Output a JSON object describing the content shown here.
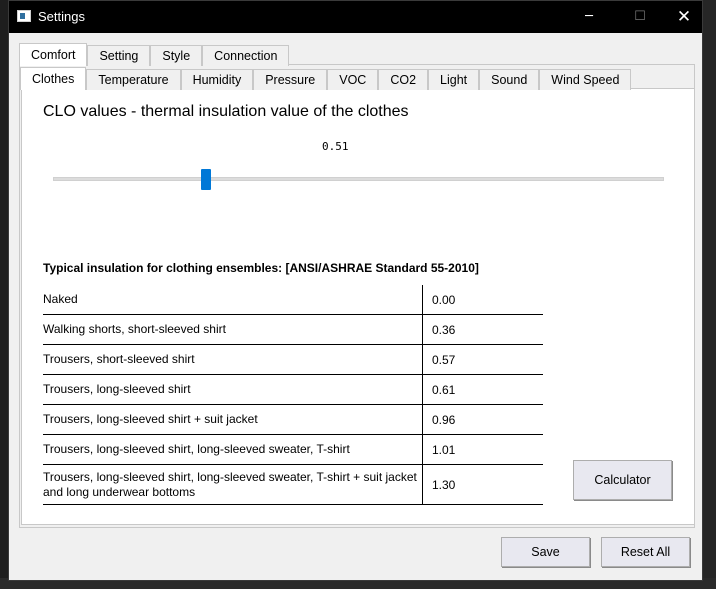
{
  "window": {
    "title": "Settings",
    "minimize": "─",
    "maximize": "☐",
    "close": "✕"
  },
  "tabs_top": [
    "Comfort",
    "Setting",
    "Style",
    "Connection"
  ],
  "tabs_sub": [
    "Clothes",
    "Temperature",
    "Humidity",
    "Pressure",
    "VOC",
    "CO2",
    "Light",
    "Sound",
    "Wind Speed"
  ],
  "clothes": {
    "heading": "CLO values - thermal insulation value of the clothes",
    "slider_value": "0.51",
    "slider_fraction": 0.25,
    "table_title": "Typical insulation for clothing ensembles: [ANSI/ASHRAE Standard 55-2010]",
    "rows": [
      {
        "label": "Naked",
        "value": "0.00"
      },
      {
        "label": "Walking shorts, short-sleeved shirt",
        "value": "0.36"
      },
      {
        "label": "Trousers, short-sleeved shirt",
        "value": "0.57"
      },
      {
        "label": "Trousers, long-sleeved shirt",
        "value": "0.61"
      },
      {
        "label": "Trousers, long-sleeved shirt + suit jacket",
        "value": "0.96"
      },
      {
        "label": "Trousers, long-sleeved shirt, long-sleeved sweater, T-shirt",
        "value": "1.01"
      },
      {
        "label": "Trousers, long-sleeved shirt, long-sleeved sweater, T-shirt + suit jacket and long underwear bottoms",
        "value": "1.30"
      }
    ],
    "calculator_label": "Calculator"
  },
  "footer": {
    "save_label": "Save",
    "reset_label": "Reset All"
  },
  "colors": {
    "accent": "#0078d7",
    "titlebar": "#000000",
    "panel": "#ffffff"
  }
}
